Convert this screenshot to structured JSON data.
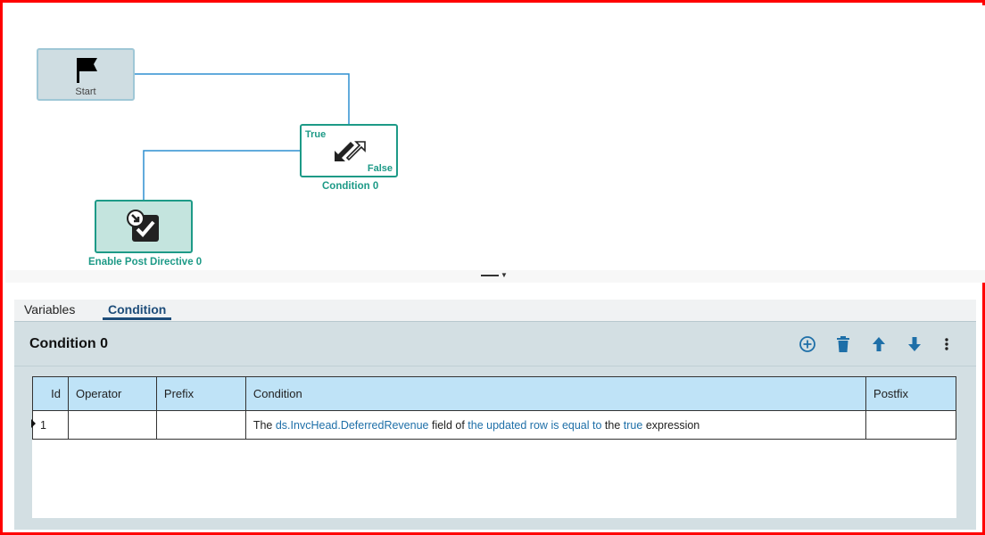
{
  "workflow": {
    "start_label": "Start",
    "condition_node": {
      "label": "Condition 0",
      "true_label": "True",
      "false_label": "False"
    },
    "enable_node": {
      "label": "Enable Post Directive 0"
    }
  },
  "tabs": [
    {
      "label": "Variables",
      "active": false
    },
    {
      "label": "Condition",
      "active": true
    }
  ],
  "condition_panel": {
    "title": "Condition 0",
    "toolbar": [
      "add-circle-icon",
      "delete-icon",
      "arrow-up-icon",
      "arrow-down-icon",
      "more-vertical-icon"
    ]
  },
  "grid": {
    "columns": [
      "Id",
      "Operator",
      "Prefix",
      "Condition",
      "Postfix"
    ],
    "rows": [
      {
        "id": "1",
        "operator": "",
        "prefix": "",
        "condition": {
          "w1": "The",
          "field": "ds.InvcHead.DeferredRevenue",
          "w2": "field of",
          "row": "the updated row",
          "op": "is equal to",
          "w3": "the",
          "value": "true",
          "w4": "expression"
        },
        "postfix": ""
      }
    ]
  },
  "colors": {
    "accent": "#1d9a87",
    "link": "#1e6fa8",
    "header": "#bfe3f7",
    "frame": "#ff0000"
  }
}
